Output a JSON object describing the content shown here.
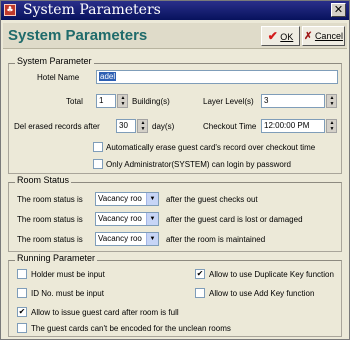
{
  "window": {
    "title": "System Parameters",
    "icon": "app-icon",
    "close_label": "✕"
  },
  "header": {
    "title": "System Parameters",
    "ok_label": "OK",
    "cancel_label": "Cancel"
  },
  "system": {
    "legend": "System Parameter",
    "hotel_name_label": "Hotel Name",
    "hotel_name_value": "adel",
    "total_label": "Total",
    "total_value": "1",
    "buildings_label": "Building(s)",
    "layer_label": "Layer Level(s)",
    "layer_value": "3",
    "del_label": "Del erased records after",
    "del_value": "30",
    "days_label": "day(s)",
    "checkout_label": "Checkout Time",
    "checkout_value": "12:00:00 PM",
    "auto_erase_label": "Automatically erase guest card's record over checkout time",
    "admin_only_label": "Only Administrator(SYSTEM) can login by password"
  },
  "room_status": {
    "legend": "Room Status",
    "rows": [
      {
        "prefix": "The room status is",
        "value": "Vacancy roo",
        "suffix": "after the guest checks out"
      },
      {
        "prefix": "The room status is",
        "value": "Vacancy roo",
        "suffix": "after the guest card is lost or damaged"
      },
      {
        "prefix": "The room status is",
        "value": "Vacancy roo",
        "suffix": "after the room is maintained"
      }
    ]
  },
  "running": {
    "legend": "Running Parameter",
    "holder_label": "Holder must be input",
    "dup_key_label": "Allow to use Duplicate Key function",
    "id_no_label": "ID No. must be input",
    "add_key_label": "Allow to use Add Key function",
    "issue_full_label": "Allow to issue guest card after room is full",
    "unclean_label": "The guest cards can't be encoded for the unclean rooms"
  },
  "colors": {
    "title_bar": "#07125d",
    "header_text": "#1f6b6b",
    "selected": "#2d5fb3"
  }
}
